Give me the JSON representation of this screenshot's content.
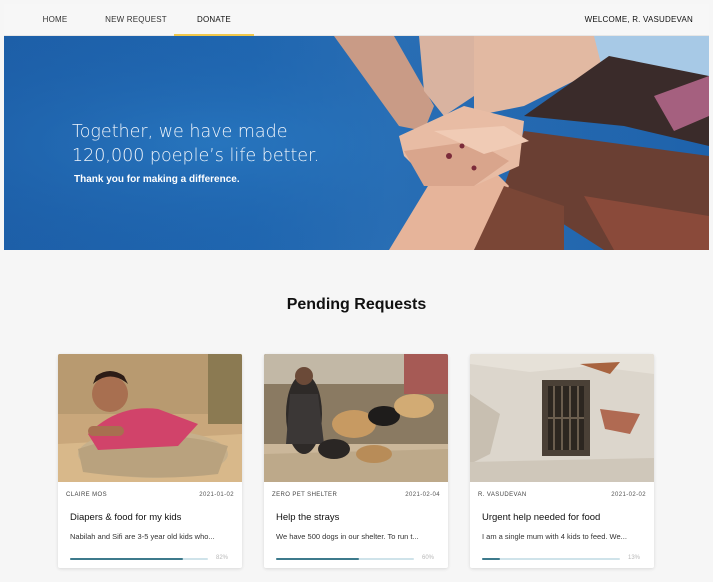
{
  "nav": {
    "items": [
      {
        "label": "HOME"
      },
      {
        "label": "NEW REQUEST"
      },
      {
        "label": "DONATE",
        "active": true
      }
    ],
    "welcome": "WELCOME, R. VASUDEVAN",
    "active_color": "#f1c84b"
  },
  "hero": {
    "title_line1": "Together, we have made",
    "title_line2": "120,000 poeple’s life better.",
    "subtitle": "Thank you for making a difference.",
    "background_color": "#1f66b0"
  },
  "section": {
    "title": "Pending Requests"
  },
  "cards": [
    {
      "owner": "CLAIRE MOS",
      "date": "2021-01-02",
      "title": "Diapers & food for my kids",
      "description": "Nabilah and Sifi are 3-5 year old kids who...",
      "progress": 0.82,
      "progress_label": "82%",
      "image": "child-on-sack-photo"
    },
    {
      "owner": "ZERO PET SHELTER",
      "date": "2021-02-04",
      "title": "Help the strays",
      "description": "We have 500 dogs in our shelter. To run t...",
      "progress": 0.6,
      "progress_label": "60%",
      "image": "woman-with-dogs-photo"
    },
    {
      "owner": "R. VASUDEVAN",
      "date": "2021-02-02",
      "title": "Urgent help needed for food",
      "description": "I am a single mum with 4 kids to feed. We...",
      "progress": 0.13,
      "progress_label": "13%",
      "image": "cracked-wall-window-photo"
    }
  ],
  "colors": {
    "progress_fill": "#3d7a8c",
    "progress_track": "#cfe3ea"
  }
}
